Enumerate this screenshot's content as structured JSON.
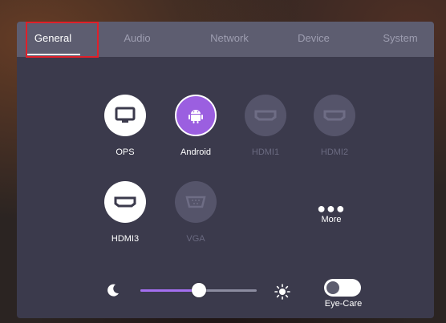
{
  "tabs": [
    {
      "label": "General",
      "active": true
    },
    {
      "label": "Audio",
      "active": false
    },
    {
      "label": "Network",
      "active": false
    },
    {
      "label": "Device",
      "active": false
    },
    {
      "label": "System",
      "active": false
    }
  ],
  "sources": [
    {
      "label": "OPS",
      "icon": "monitor-icon",
      "state": "available"
    },
    {
      "label": "Android",
      "icon": "android-icon",
      "state": "selected"
    },
    {
      "label": "HDMI1",
      "icon": "hdmi-icon",
      "state": "disabled"
    },
    {
      "label": "HDMI2",
      "icon": "hdmi-icon",
      "state": "disabled"
    },
    {
      "label": "HDMI3",
      "icon": "hdmi-icon",
      "state": "available"
    },
    {
      "label": "VGA",
      "icon": "vga-icon",
      "state": "disabled"
    }
  ],
  "more": {
    "label": "More",
    "icon": "more-dots-icon"
  },
  "brightness": {
    "value": 0.5,
    "min_icon": "moon-icon",
    "max_icon": "sun-icon"
  },
  "eye_care": {
    "label": "Eye-Care",
    "enabled": false
  },
  "colors": {
    "accent": "#9b5fe0",
    "panel": "#3b3a4c",
    "tabbar": "#5d5d70",
    "highlight": "#e0202a"
  }
}
